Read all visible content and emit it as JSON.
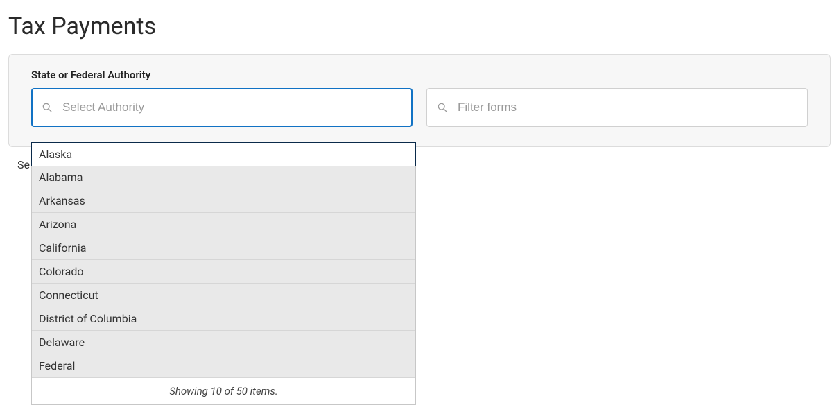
{
  "page": {
    "title": "Tax Payments"
  },
  "form": {
    "authority_label": "State or Federal Authority",
    "authority_placeholder": "Select Authority",
    "filter_placeholder": "Filter forms",
    "behind_text": "Sel"
  },
  "dropdown": {
    "items": [
      "Alaska",
      "Alabama",
      "Arkansas",
      "Arizona",
      "California",
      "Colorado",
      "Connecticut",
      "District of Columbia",
      "Delaware",
      "Federal"
    ],
    "footer": "Showing 10 of 50 items."
  }
}
